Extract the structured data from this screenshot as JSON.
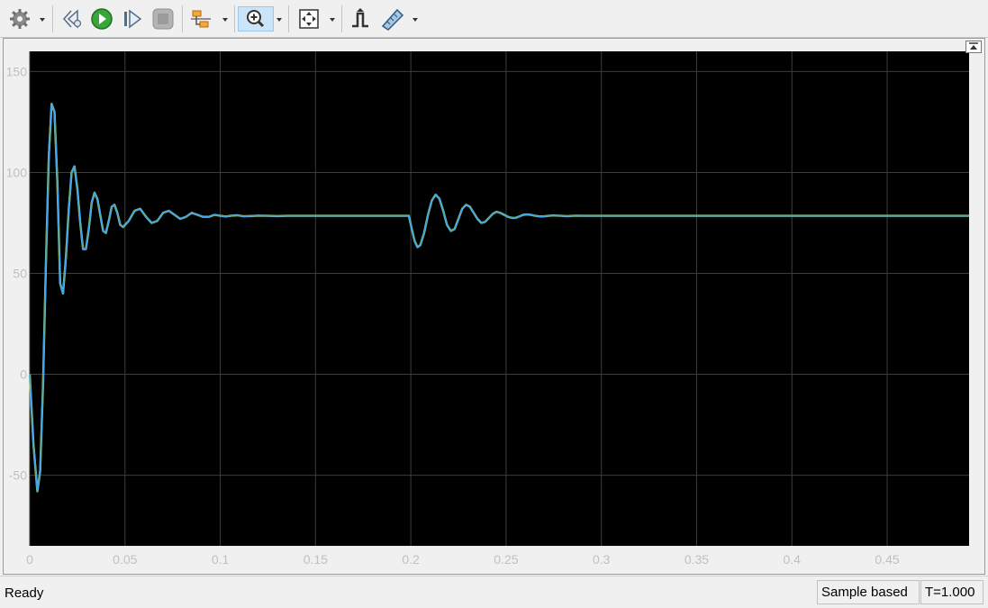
{
  "toolbar": {
    "icons": [
      "gear-icon",
      "step-back-icon",
      "run-icon",
      "step-forward-icon",
      "stop-icon",
      "signal-selector-icon",
      "zoom-in-icon",
      "fit-to-view-icon",
      "trigger-icon",
      "cursor-measurements-icon"
    ]
  },
  "status": {
    "ready": "Ready",
    "mode": "Sample based",
    "time": "T=1.000"
  },
  "colors": {
    "plot_background": "#000000",
    "grid": "#3d3d3d",
    "tick_label": "#c0c0c0",
    "signal": "#3fa6ee",
    "signal_secondary": "#e6e600"
  },
  "chart_data": {
    "type": "line",
    "title": "",
    "xlabel": "",
    "ylabel": "",
    "xlim": [
      0,
      0.493
    ],
    "ylim": [
      -85,
      160
    ],
    "x_ticks": [
      0,
      0.05,
      0.1,
      0.15,
      0.2,
      0.25,
      0.3,
      0.35,
      0.4,
      0.45
    ],
    "x_tick_labels": [
      "0",
      "0.05",
      "0.1",
      "0.15",
      "0.2",
      "0.25",
      "0.3",
      "0.35",
      "0.4",
      "0.45"
    ],
    "y_ticks": [
      -50,
      0,
      50,
      100,
      150
    ],
    "y_tick_labels": [
      "-50",
      "0",
      "50",
      "100",
      "150"
    ],
    "grid": true,
    "series": [
      {
        "x": [
          0,
          0.002,
          0.004,
          0.0055,
          0.007,
          0.0085,
          0.01,
          0.0115,
          0.013,
          0.0145,
          0.016,
          0.0175,
          0.019,
          0.0205,
          0.022,
          0.0235,
          0.025,
          0.0265,
          0.028,
          0.0295,
          0.031,
          0.0325,
          0.034,
          0.0355,
          0.037,
          0.0385,
          0.04,
          0.0415,
          0.043,
          0.0445,
          0.046,
          0.0475,
          0.049,
          0.052,
          0.055,
          0.058,
          0.061,
          0.064,
          0.067,
          0.07,
          0.073,
          0.076,
          0.079,
          0.082,
          0.085,
          0.088,
          0.091,
          0.094,
          0.097,
          0.1,
          0.103,
          0.106,
          0.109,
          0.112,
          0.115,
          0.12,
          0.125,
          0.13,
          0.135,
          0.14,
          0.15,
          0.16,
          0.17,
          0.18,
          0.19,
          0.199,
          0.2005,
          0.202,
          0.2035,
          0.205,
          0.207,
          0.209,
          0.211,
          0.213,
          0.215,
          0.217,
          0.219,
          0.221,
          0.223,
          0.225,
          0.227,
          0.229,
          0.231,
          0.233,
          0.235,
          0.237,
          0.239,
          0.241,
          0.243,
          0.245,
          0.247,
          0.249,
          0.251,
          0.253,
          0.255,
          0.257,
          0.259,
          0.261,
          0.263,
          0.265,
          0.267,
          0.269,
          0.271,
          0.273,
          0.275,
          0.277,
          0.279,
          0.281,
          0.283,
          0.285,
          0.287,
          0.29,
          0.295,
          0.3,
          0.31,
          0.35,
          0.4,
          0.45,
          0.493
        ],
        "y": [
          0,
          -35,
          -58,
          -48,
          -5,
          55,
          108,
          134,
          130,
          95,
          45,
          40,
          58,
          82,
          100,
          103,
          92,
          75,
          62,
          62,
          72,
          85,
          90,
          87,
          79,
          71,
          70,
          76,
          83,
          84,
          80,
          74,
          73,
          76,
          81,
          82,
          78,
          75,
          76,
          80,
          81,
          79,
          77,
          78,
          80,
          79,
          78,
          78,
          79,
          78.5,
          78.2,
          78.6,
          78.8,
          78.3,
          78.4,
          78.6,
          78.5,
          78.4,
          78.5,
          78.5,
          78.5,
          78.5,
          78.5,
          78.5,
          78.5,
          78.5,
          72,
          66,
          63,
          64,
          70,
          79,
          86,
          89,
          87,
          81,
          74,
          71,
          72,
          77,
          82,
          84,
          83,
          80,
          77,
          75,
          75.5,
          77.5,
          79.5,
          80.5,
          80,
          79,
          78,
          77.5,
          77.5,
          78.2,
          79,
          79.2,
          79,
          78.6,
          78.3,
          78.2,
          78.4,
          78.6,
          78.7,
          78.6,
          78.5,
          78.4,
          78.4,
          78.5,
          78.6,
          78.5,
          78.5,
          78.5,
          78.5,
          78.5,
          78.5,
          78.5,
          78.5
        ]
      }
    ]
  }
}
